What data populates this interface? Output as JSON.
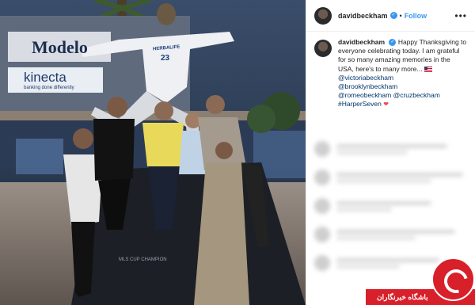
{
  "photo": {
    "sign_brand": "Modelo",
    "sign_kinecta": "kinecta",
    "sign_kinecta_sub": "banking done differently",
    "statue_jersey": "HERBALIFE",
    "statue_number": "23",
    "plinth_text": "MLS CUP CHAMPION"
  },
  "post": {
    "username": "davidbeckham",
    "follow_label": "Follow",
    "more_icon": "more-horizontal-icon",
    "verified_icon": "verified-badge-icon",
    "caption": {
      "username": "davidbeckham",
      "text": "Happy Thanksgiving to everyone celebrating today. I am grateful for so many amazing memories in the USA, here's to many more...",
      "mentions": [
        "@victoriabeckham",
        "@brooklynbeckham",
        "@romeobeckham",
        "@cruzbeckham"
      ],
      "hashtag": "#HarperSeven"
    }
  },
  "watermark": {
    "label": "باشگاه خبرنگاران"
  },
  "colors": {
    "link": "#003569",
    "follow": "#3897f0",
    "watermark": "#d8202a"
  }
}
